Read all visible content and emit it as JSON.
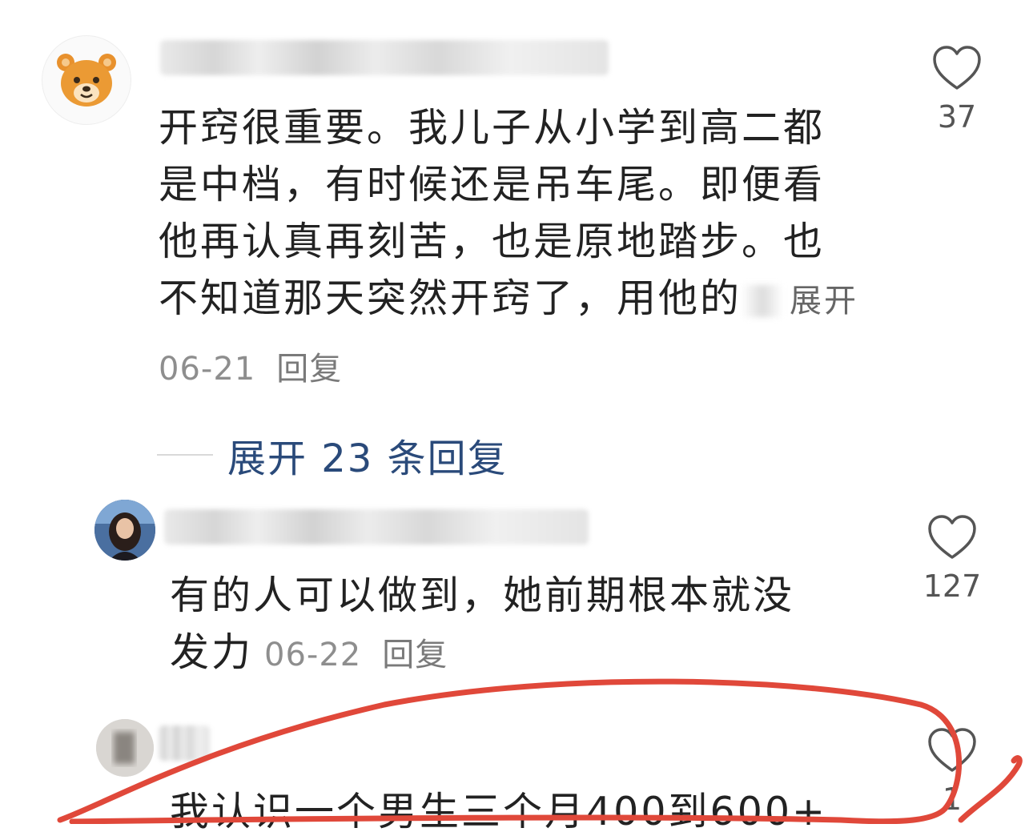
{
  "comments": [
    {
      "avatar_icon": "bear-avatar-icon",
      "lines": [
        "开窍很重要。我儿子从小学到高二都",
        "是中档，有时候还是吊车尾。即便看",
        "他再认真再刻苦，也是原地踏步。也",
        "不知道那天突然开窍了，用他的"
      ],
      "expand_label": "展开",
      "date": "06-21",
      "reply_label": "回复",
      "like_count": "37"
    },
    {
      "avatar_icon": "woman-photo-avatar",
      "lines": [
        "有的人可以做到，她前期根本就没",
        "发力"
      ],
      "date": "06-22",
      "reply_label": "回复",
      "like_count": "127"
    },
    {
      "avatar_icon": "blurred-photo-avatar",
      "lines": [
        "我认识一个男生三个月400到600+"
      ],
      "like_count": "1"
    }
  ],
  "expand_replies": {
    "label": "展开 23 条回复"
  },
  "colors": {
    "link": "#2a4a7a",
    "markup": "#e0483a",
    "meta": "#8e8e8e"
  }
}
